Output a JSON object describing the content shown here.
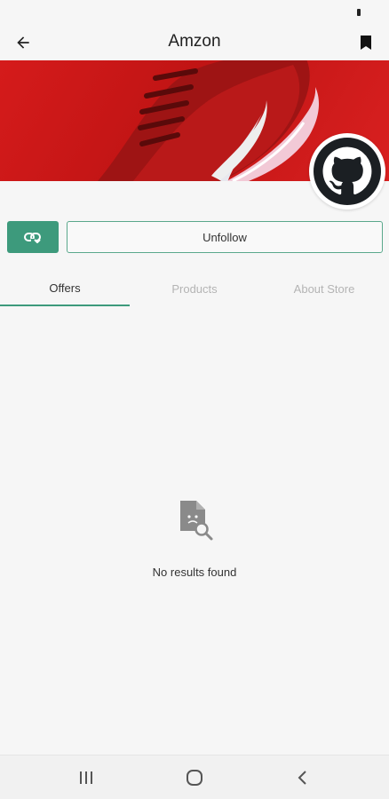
{
  "header": {
    "title": "Amzon"
  },
  "icons": {
    "back": "arrow-left-icon",
    "bookmark": "bookmark-icon",
    "share": "link-share-icon",
    "avatar": "github-icon",
    "empty": "file-search-icon"
  },
  "actions": {
    "unfollow_label": "Unfollow"
  },
  "tabs": [
    {
      "label": "Offers",
      "active": true
    },
    {
      "label": "Products",
      "active": false
    },
    {
      "label": "About Store",
      "active": false
    }
  ],
  "empty_state": {
    "message": "No results found"
  },
  "colors": {
    "accent": "#3d9a7c",
    "banner": "#c81818",
    "background": "#f6f6f6"
  }
}
